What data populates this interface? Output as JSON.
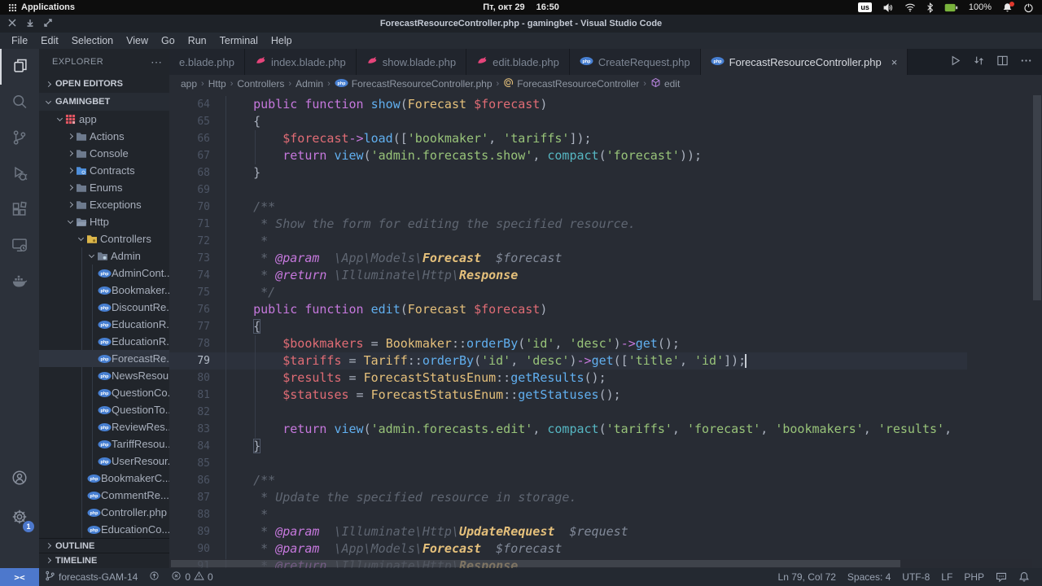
{
  "os_bar": {
    "applications_label": "Applications",
    "date": "Пт, окт 29",
    "time": "16:50",
    "keyboard_layout": "us",
    "battery_percent": "100%",
    "tray_icons": [
      "volume-icon",
      "wifi-icon",
      "bluetooth-icon",
      "battery-icon",
      "notifications-icon",
      "power-icon"
    ]
  },
  "window": {
    "title": "ForecastResourceController.php - gamingbet - Visual Studio Code",
    "controls": [
      "close",
      "minimize",
      "maximize"
    ]
  },
  "menu": [
    "File",
    "Edit",
    "Selection",
    "View",
    "Go",
    "Run",
    "Terminal",
    "Help"
  ],
  "activity_bar": {
    "items": [
      {
        "name": "explorer",
        "icon": "files-icon",
        "active": true
      },
      {
        "name": "search",
        "icon": "search-icon"
      },
      {
        "name": "source-control",
        "icon": "git-icon"
      },
      {
        "name": "run-debug",
        "icon": "debug-icon"
      },
      {
        "name": "extensions",
        "icon": "extensions-icon"
      },
      {
        "name": "remote-explorer",
        "icon": "remote-icon"
      },
      {
        "name": "docker",
        "icon": "docker-icon"
      }
    ],
    "bottom": [
      {
        "name": "accounts",
        "icon": "account-icon"
      },
      {
        "name": "settings",
        "icon": "gear-icon",
        "badge": "1"
      }
    ]
  },
  "explorer": {
    "header": "EXPLORER",
    "more": "⋯",
    "sections": {
      "open_editors": "OPEN EDITORS",
      "project": "GAMINGBET",
      "outline": "OUTLINE",
      "timeline": "TIMELINE"
    },
    "tree": [
      {
        "label": "app",
        "indent": 1,
        "chevron": "d",
        "icon": "app"
      },
      {
        "label": "Actions",
        "indent": 2,
        "chevron": "r",
        "icon": "folder"
      },
      {
        "label": "Console",
        "indent": 2,
        "chevron": "r",
        "icon": "folder"
      },
      {
        "label": "Contracts",
        "indent": 2,
        "chevron": "r",
        "icon": "folder-blue"
      },
      {
        "label": "Enums",
        "indent": 2,
        "chevron": "r",
        "icon": "folder"
      },
      {
        "label": "Exceptions",
        "indent": 2,
        "chevron": "r",
        "icon": "folder"
      },
      {
        "label": "Http",
        "indent": 2,
        "chevron": "d",
        "icon": "folder-open"
      },
      {
        "label": "Controllers",
        "indent": 3,
        "chevron": "d",
        "icon": "folder-yellow"
      },
      {
        "label": "Admin",
        "indent": 4,
        "chevron": "d",
        "icon": "folder-admin"
      },
      {
        "label": "AdminCont...",
        "indent": 5,
        "icon": "php"
      },
      {
        "label": "Bookmaker...",
        "indent": 5,
        "icon": "php"
      },
      {
        "label": "DiscountRe...",
        "indent": 5,
        "icon": "php"
      },
      {
        "label": "EducationR...",
        "indent": 5,
        "icon": "php"
      },
      {
        "label": "EducationR...",
        "indent": 5,
        "icon": "php"
      },
      {
        "label": "ForecastRe...",
        "indent": 5,
        "icon": "php",
        "selected": true
      },
      {
        "label": "NewsResou...",
        "indent": 5,
        "icon": "php"
      },
      {
        "label": "QuestionCo...",
        "indent": 5,
        "icon": "php"
      },
      {
        "label": "QuestionTo...",
        "indent": 5,
        "icon": "php"
      },
      {
        "label": "ReviewRes...",
        "indent": 5,
        "icon": "php"
      },
      {
        "label": "TariffResou...",
        "indent": 5,
        "icon": "php"
      },
      {
        "label": "UserResour...",
        "indent": 5,
        "icon": "php"
      },
      {
        "label": "BookmakerC...",
        "indent": 4,
        "icon": "php"
      },
      {
        "label": "CommentRe...",
        "indent": 4,
        "icon": "php"
      },
      {
        "label": "Controller.php",
        "indent": 4,
        "icon": "php"
      },
      {
        "label": "EducationCo...",
        "indent": 4,
        "icon": "php"
      }
    ]
  },
  "tabs": [
    {
      "label": "e.blade.php",
      "icon": null
    },
    {
      "label": "index.blade.php",
      "icon": "blade"
    },
    {
      "label": "show.blade.php",
      "icon": "blade"
    },
    {
      "label": "edit.blade.php",
      "icon": "blade"
    },
    {
      "label": "CreateRequest.php",
      "icon": "php"
    },
    {
      "label": "ForecastResourceController.php",
      "icon": "php",
      "active": true,
      "close": "×"
    }
  ],
  "tab_actions": [
    "run-icon",
    "changes-icon",
    "split-editor-icon",
    "more-actions-icon"
  ],
  "breadcrumbs": [
    {
      "label": "app"
    },
    {
      "label": "Http"
    },
    {
      "label": "Controllers"
    },
    {
      "label": "Admin"
    },
    {
      "label": "ForecastResourceController.php",
      "icon": "php"
    },
    {
      "label": "ForecastResourceController",
      "icon": "class-symbol"
    },
    {
      "label": "edit",
      "icon": "method-symbol"
    }
  ],
  "editor": {
    "first_line": 64,
    "current_line": 79,
    "cursor": {
      "line": 79,
      "col": 72
    },
    "lines": [
      [
        [
          "pun",
          "    "
        ],
        [
          "kw",
          "public"
        ],
        [
          "pun",
          " "
        ],
        [
          "kw",
          "function"
        ],
        [
          "pun",
          " "
        ],
        [
          "fn",
          "show"
        ],
        [
          "pun",
          "("
        ],
        [
          "cls",
          "Forecast"
        ],
        [
          "pun",
          " "
        ],
        [
          "var",
          "$forecast"
        ],
        [
          "pun",
          ")"
        ]
      ],
      [
        [
          "pun",
          "    {"
        ]
      ],
      [
        [
          "pun",
          "        "
        ],
        [
          "var",
          "$forecast"
        ],
        [
          "op",
          "->"
        ],
        [
          "fn",
          "load"
        ],
        [
          "pun",
          "(["
        ],
        [
          "str",
          "'bookmaker'"
        ],
        [
          "pun",
          ", "
        ],
        [
          "str",
          "'tariffs'"
        ],
        [
          "pun",
          "]);"
        ]
      ],
      [
        [
          "pun",
          "        "
        ],
        [
          "kw",
          "return"
        ],
        [
          "pun",
          " "
        ],
        [
          "fn",
          "view"
        ],
        [
          "pun",
          "("
        ],
        [
          "str",
          "'admin.forecasts.show'"
        ],
        [
          "pun",
          ", "
        ],
        [
          "cy",
          "compact"
        ],
        [
          "pun",
          "("
        ],
        [
          "str",
          "'forecast'"
        ],
        [
          "pun",
          "));"
        ]
      ],
      [
        [
          "pun",
          "    }"
        ]
      ],
      [],
      [
        [
          "cmt",
          "    /**"
        ]
      ],
      [
        [
          "cmt",
          "     * Show the form for editing the specified resource."
        ]
      ],
      [
        [
          "cmt",
          "     *"
        ]
      ],
      [
        [
          "cmt",
          "     * "
        ],
        [
          "tag",
          "@param"
        ],
        [
          "cmt",
          "  "
        ],
        [
          "nsi",
          "\\App\\Models\\"
        ],
        [
          "cli",
          "Forecast"
        ],
        [
          "cmt",
          "  "
        ],
        [
          "pri",
          "$forecast"
        ]
      ],
      [
        [
          "cmt",
          "     * "
        ],
        [
          "tag",
          "@return"
        ],
        [
          "cmt",
          " "
        ],
        [
          "nsi",
          "\\Illuminate\\Http\\"
        ],
        [
          "cli",
          "Response"
        ]
      ],
      [
        [
          "cmt",
          "     */"
        ]
      ],
      [
        [
          "pun",
          "    "
        ],
        [
          "kw",
          "public"
        ],
        [
          "pun",
          " "
        ],
        [
          "kw",
          "function"
        ],
        [
          "pun",
          " "
        ],
        [
          "fn",
          "edit"
        ],
        [
          "pun",
          "("
        ],
        [
          "cls",
          "Forecast"
        ],
        [
          "pun",
          " "
        ],
        [
          "var",
          "$forecast"
        ],
        [
          "pun",
          ")"
        ]
      ],
      [
        [
          "pun",
          "    "
        ],
        [
          "brk",
          "{"
        ]
      ],
      [
        [
          "pun",
          "        "
        ],
        [
          "var",
          "$bookmakers"
        ],
        [
          "pun",
          " = "
        ],
        [
          "cls",
          "Bookmaker"
        ],
        [
          "pun",
          "::"
        ],
        [
          "fn",
          "orderBy"
        ],
        [
          "pun",
          "("
        ],
        [
          "str",
          "'id'"
        ],
        [
          "pun",
          ", "
        ],
        [
          "str",
          "'desc'"
        ],
        [
          "pun",
          ")"
        ],
        [
          "op",
          "->"
        ],
        [
          "fn",
          "get"
        ],
        [
          "pun",
          "();"
        ]
      ],
      [
        [
          "pun",
          "        "
        ],
        [
          "var",
          "$tariffs"
        ],
        [
          "pun",
          " = "
        ],
        [
          "cls",
          "Tariff"
        ],
        [
          "pun",
          "::"
        ],
        [
          "fn",
          "orderBy"
        ],
        [
          "pun",
          "("
        ],
        [
          "str",
          "'id'"
        ],
        [
          "pun",
          ", "
        ],
        [
          "str",
          "'desc'"
        ],
        [
          "pun",
          ")"
        ],
        [
          "op",
          "->"
        ],
        [
          "fn",
          "get"
        ],
        [
          "pun",
          "(["
        ],
        [
          "str",
          "'title'"
        ],
        [
          "pun",
          ", "
        ],
        [
          "str",
          "'id'"
        ],
        [
          "pun",
          "]);"
        ]
      ],
      [
        [
          "pun",
          "        "
        ],
        [
          "var",
          "$results"
        ],
        [
          "pun",
          " = "
        ],
        [
          "cls",
          "ForecastStatusEnum"
        ],
        [
          "pun",
          "::"
        ],
        [
          "fn",
          "getResults"
        ],
        [
          "pun",
          "();"
        ]
      ],
      [
        [
          "pun",
          "        "
        ],
        [
          "var",
          "$statuses"
        ],
        [
          "pun",
          " = "
        ],
        [
          "cls",
          "ForecastStatusEnum"
        ],
        [
          "pun",
          "::"
        ],
        [
          "fn",
          "getStatuses"
        ],
        [
          "pun",
          "();"
        ]
      ],
      [],
      [
        [
          "pun",
          "        "
        ],
        [
          "kw",
          "return"
        ],
        [
          "pun",
          " "
        ],
        [
          "fn",
          "view"
        ],
        [
          "pun",
          "("
        ],
        [
          "str",
          "'admin.forecasts.edit'"
        ],
        [
          "pun",
          ", "
        ],
        [
          "cy",
          "compact"
        ],
        [
          "pun",
          "("
        ],
        [
          "str",
          "'tariffs'"
        ],
        [
          "pun",
          ", "
        ],
        [
          "str",
          "'forecast'"
        ],
        [
          "pun",
          ", "
        ],
        [
          "str",
          "'bookmakers'"
        ],
        [
          "pun",
          ", "
        ],
        [
          "str",
          "'results'"
        ],
        [
          "pun",
          ","
        ]
      ],
      [
        [
          "pun",
          "    "
        ],
        [
          "brk",
          "}"
        ]
      ],
      [],
      [
        [
          "cmt",
          "    /**"
        ]
      ],
      [
        [
          "cmt",
          "     * Update the specified resource in storage."
        ]
      ],
      [
        [
          "cmt",
          "     *"
        ]
      ],
      [
        [
          "cmt",
          "     * "
        ],
        [
          "tag",
          "@param"
        ],
        [
          "cmt",
          "  "
        ],
        [
          "nsi",
          "\\Illuminate\\Http\\"
        ],
        [
          "cli",
          "UpdateRequest"
        ],
        [
          "cmt",
          "  "
        ],
        [
          "pri",
          "$request"
        ]
      ],
      [
        [
          "cmt",
          "     * "
        ],
        [
          "tag",
          "@param"
        ],
        [
          "cmt",
          "  "
        ],
        [
          "nsi",
          "\\App\\Models\\"
        ],
        [
          "cli",
          "Forecast"
        ],
        [
          "cmt",
          "  "
        ],
        [
          "pri",
          "$forecast"
        ]
      ],
      [
        [
          "cmt",
          "     * "
        ],
        [
          "tag",
          "@return"
        ],
        [
          "cmt",
          " "
        ],
        [
          "nsi",
          "\\Illuminate\\Http\\"
        ],
        [
          "cli",
          "Response"
        ]
      ]
    ]
  },
  "status_bar": {
    "branch": "forecasts-GAM-14",
    "errors": "0",
    "warnings": "0",
    "right": [
      "Ln 79, Col 72",
      "Spaces: 4",
      "UTF-8",
      "LF",
      "PHP"
    ],
    "right_icons": [
      "feedback-icon",
      "bell-icon"
    ]
  },
  "colors": {
    "accent_blue": "#4d78cc",
    "keyword": "#c678dd",
    "function": "#61afef",
    "class": "#e5c07b",
    "variable": "#e06c75",
    "string": "#98c379",
    "support": "#56b6c2",
    "comment": "#5f6672",
    "punctuation": "#abb2bf",
    "blade_icon": "#e5447a",
    "php_icon": "#477fd1"
  }
}
